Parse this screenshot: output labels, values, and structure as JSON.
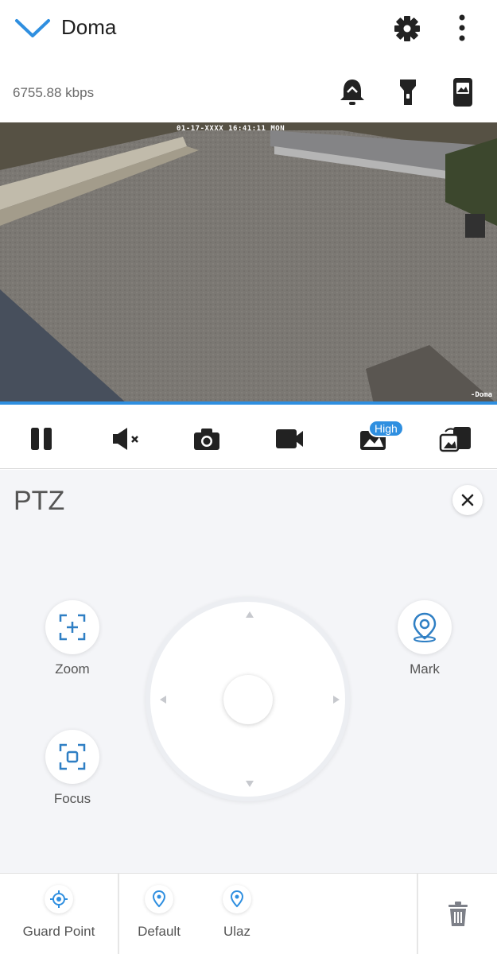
{
  "header": {
    "title": "Doma",
    "icons": {
      "collapse": "chevron-down-icon",
      "settings": "gear-icon",
      "more": "more-vert-icon"
    }
  },
  "subbar": {
    "bitrate": "6755.88 kbps",
    "icons": [
      "alarm-bell-icon",
      "flashlight-icon",
      "device-image-icon"
    ]
  },
  "video": {
    "timestamp": "01-17-XXXX 16:41:11 MON",
    "camera_label": "-Doma"
  },
  "toolbar": {
    "buttons": [
      "pause-icon",
      "mute-icon",
      "snapshot-icon",
      "record-icon",
      "quality-icon",
      "multiview-icon"
    ],
    "quality_badge": "High"
  },
  "ptz": {
    "title": "PTZ",
    "zoom_label": "Zoom",
    "focus_label": "Focus",
    "mark_label": "Mark"
  },
  "presets": {
    "items": [
      {
        "label": "Guard Point",
        "icon": "target-icon"
      },
      {
        "label": "Default",
        "icon": "location-pin-icon"
      },
      {
        "label": "Ulaz",
        "icon": "location-pin-icon"
      }
    ],
    "delete_icon": "trash-icon"
  },
  "colors": {
    "accent": "#2f8fe0",
    "icon_dark": "#222222",
    "panel_bg": "#f4f5f8"
  }
}
